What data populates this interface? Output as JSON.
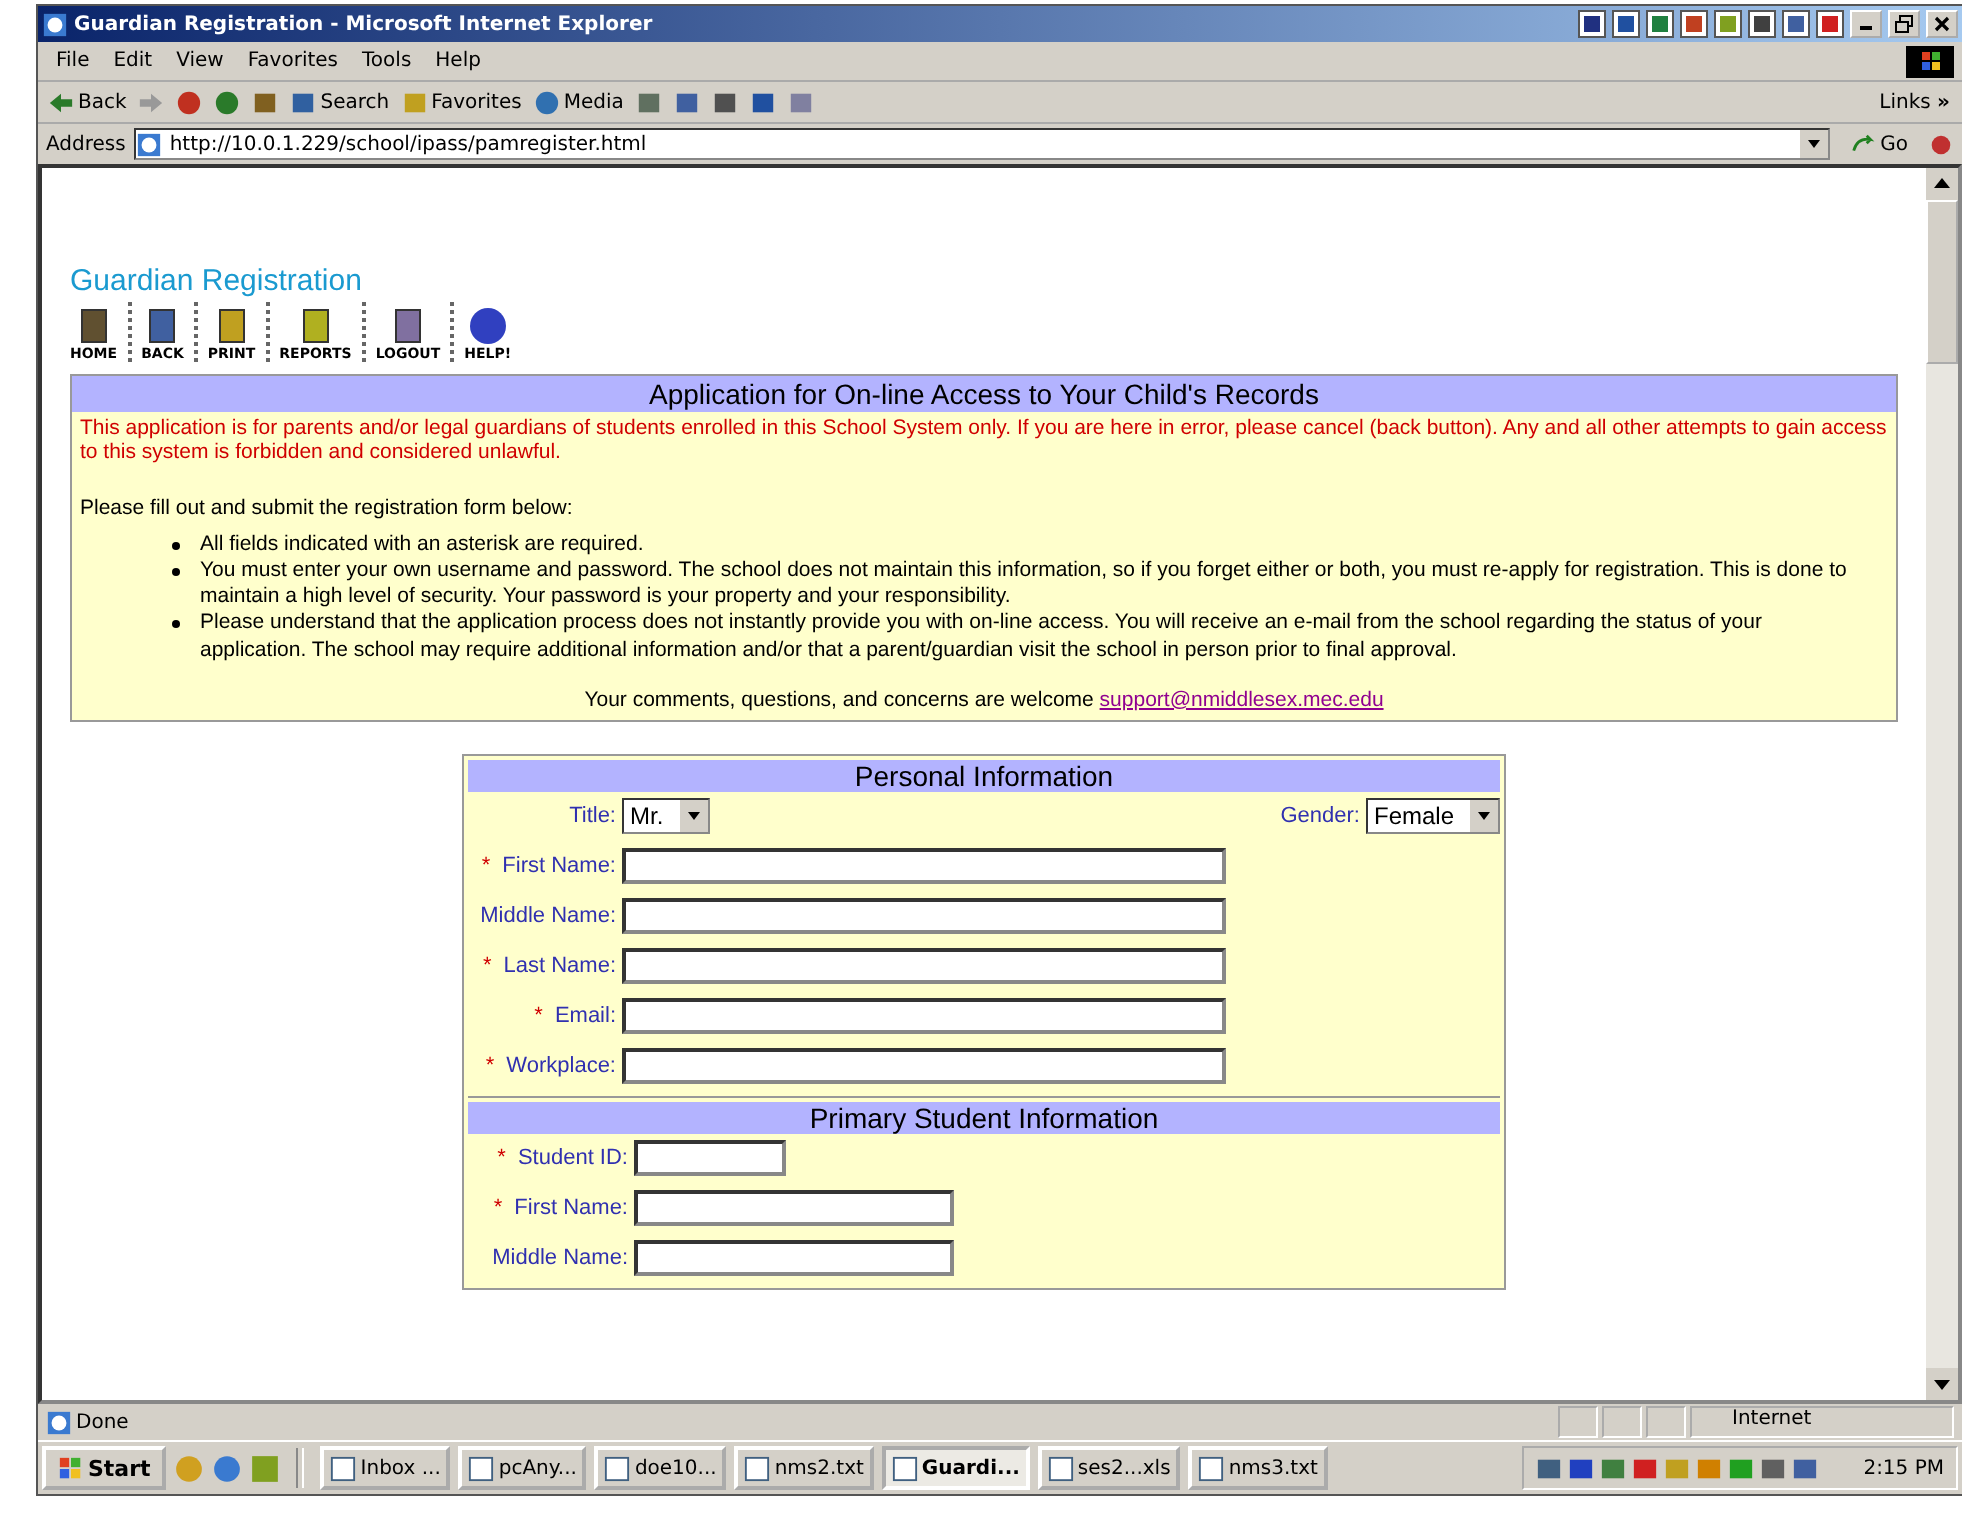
{
  "window": {
    "title": "Guardian Registration - Microsoft Internet Explorer"
  },
  "menu": [
    "File",
    "Edit",
    "View",
    "Favorites",
    "Tools",
    "Help"
  ],
  "toolbar": [
    {
      "kind": "back",
      "label": "Back"
    },
    {
      "kind": "forward"
    },
    {
      "kind": "stop"
    },
    {
      "kind": "refresh"
    },
    {
      "kind": "home"
    },
    {
      "kind": "search",
      "label": "Search"
    },
    {
      "kind": "favorites",
      "label": "Favorites"
    },
    {
      "kind": "media",
      "label": "Media"
    },
    {
      "kind": "history"
    },
    {
      "kind": "mail"
    },
    {
      "kind": "print"
    },
    {
      "kind": "word"
    },
    {
      "kind": "discuss"
    }
  ],
  "links": {
    "label": "Links",
    "chevron": "»"
  },
  "address": {
    "label": "Address",
    "url": "http://10.0.1.229/school/ipass/pamregister.html",
    "go": "Go"
  },
  "page": {
    "heading": "Guardian Registration",
    "nav": [
      {
        "kind": "home",
        "label": "HOME"
      },
      {
        "kind": "back",
        "label": "BACK"
      },
      {
        "kind": "print",
        "label": "PRINT"
      },
      {
        "kind": "reports",
        "label": "REPORTS"
      },
      {
        "kind": "logout",
        "label": "LOGOUT"
      },
      {
        "kind": "help",
        "label": "HELP!"
      }
    ],
    "notice": {
      "title": "Application for On-line Access to Your Child's Records",
      "warning": "This application is for parents and/or legal guardians of students enrolled in this School System only. If you are here in error, please cancel (back button). Any and all other attempts to gain access to this system is forbidden and considered unlawful.",
      "instruction": "Please fill out and submit the registration form below:",
      "bullets": [
        "All fields indicated with an asterisk are required.",
        "You must enter your own username and password. The school does not maintain this information, so if you forget either or both, you must re-apply for registration. This is done to maintain a high level of security. Your password is your property and your responsibility.",
        "Please understand that the application process does not instantly provide you with on-line access. You will receive an e-mail from the school regarding the status of your application. The school may require additional information and/or that a parent/guardian visit the school in person prior to final approval."
      ],
      "comment": "Your comments, questions, and concerns are welcome",
      "email": "support@nmiddlesex.mec.edu"
    },
    "sections": [
      {
        "title": "Personal Information",
        "rows": [
          [
            {
              "kind": "select",
              "label": "Title:",
              "value": "Mr."
            },
            {
              "kind": "select",
              "label": "Gender:",
              "value": "Female"
            }
          ],
          [
            {
              "kind": "long_text",
              "label": "First Name:",
              "marker": "*"
            }
          ],
          [
            {
              "kind": "long_text",
              "label": "Middle Name:"
            }
          ],
          [
            {
              "kind": "long_text",
              "label": "Last Name:",
              "marker": "*"
            }
          ],
          [
            {
              "kind": "long_text",
              "label": "Email:",
              "marker": "*"
            }
          ],
          [
            {
              "kind": "long_text",
              "label": "Workplace:",
              "marker": "*"
            }
          ]
        ]
      },
      {
        "title": "Primary Student Information",
        "rows": [
          [
            {
              "kind": "short_text",
              "label": "Student ID:",
              "marker": "*"
            }
          ],
          [
            {
              "kind": "medium_text",
              "label": "First Name:",
              "marker": "*"
            }
          ],
          [
            {
              "kind": "medium_text",
              "label": "Middle Name:"
            }
          ]
        ]
      }
    ]
  },
  "status": {
    "text": "Done",
    "zone": "Internet"
  },
  "taskbar": {
    "start": "Start",
    "tasks": [
      {
        "label": "Inbox ...",
        "selected": false
      },
      {
        "label": "pcAny...",
        "selected": false
      },
      {
        "label": "doe10...",
        "selected": false
      },
      {
        "label": "nms2.txt",
        "selected": false
      },
      {
        "label": "Guardi...",
        "selected": true
      },
      {
        "label": "ses2...xls",
        "selected": false
      },
      {
        "label": "nms3.txt",
        "selected": false
      }
    ],
    "clock": "2:15 PM"
  }
}
